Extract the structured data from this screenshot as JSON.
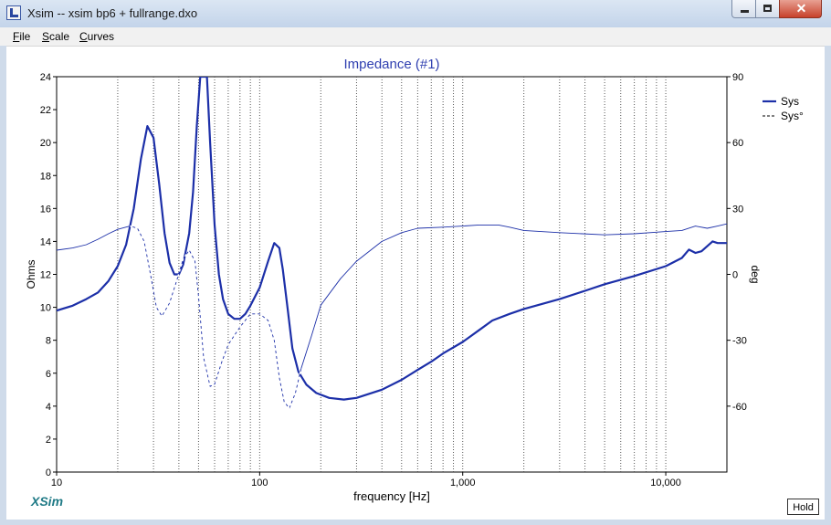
{
  "window": {
    "title": "Xsim -- xsim bp6 + fullrange.dxo",
    "icon": "xsim-app-icon"
  },
  "menu": {
    "file": {
      "first": "F",
      "rest": "ile"
    },
    "scale": {
      "first": "S",
      "rest": "cale"
    },
    "curves": {
      "first": "C",
      "rest": "urves"
    }
  },
  "branding": "XSim",
  "hold_label": "Hold",
  "colors": {
    "curve": "#1c2fa8",
    "title": "#2f3fb0",
    "grid": "#555555",
    "logo": "#1f7a86"
  },
  "chart_data": {
    "type": "line",
    "title": "Impedance (#1)",
    "xlabel": "frequency [Hz]",
    "ylabel": "Ohms",
    "y2label": "deg",
    "xscale": "log",
    "xlim": [
      10,
      20000
    ],
    "ylim": [
      0,
      24
    ],
    "y2lim": [
      -90,
      90
    ],
    "xticks": [
      10,
      100,
      1000,
      10000
    ],
    "xtick_labels": [
      "10",
      "100",
      "1,000",
      "10,000"
    ],
    "yticks": [
      0,
      2,
      4,
      6,
      8,
      10,
      12,
      14,
      16,
      18,
      20,
      22,
      24
    ],
    "y2ticks": [
      -60,
      -30,
      0,
      30,
      60,
      90
    ],
    "grid": true,
    "legend_position": "top-right",
    "series": [
      {
        "name": "Sys",
        "axis": "left",
        "style": "solid-bold",
        "points": [
          [
            10,
            9.8
          ],
          [
            12,
            10.1
          ],
          [
            14,
            10.5
          ],
          [
            16,
            10.9
          ],
          [
            18,
            11.6
          ],
          [
            20,
            12.5
          ],
          [
            22,
            13.8
          ],
          [
            24,
            16.0
          ],
          [
            26,
            19.0
          ],
          [
            28,
            21.0
          ],
          [
            30,
            20.3
          ],
          [
            32,
            17.5
          ],
          [
            34,
            14.5
          ],
          [
            36,
            12.7
          ],
          [
            38,
            12.0
          ],
          [
            40,
            12.0
          ],
          [
            42,
            12.6
          ],
          [
            45,
            14.5
          ],
          [
            47,
            17.0
          ],
          [
            49,
            21.0
          ],
          [
            51,
            24.0
          ],
          [
            55,
            24.0
          ],
          [
            57,
            20.0
          ],
          [
            60,
            15.0
          ],
          [
            63,
            12.0
          ],
          [
            66,
            10.5
          ],
          [
            70,
            9.6
          ],
          [
            75,
            9.3
          ],
          [
            80,
            9.3
          ],
          [
            85,
            9.6
          ],
          [
            90,
            10.1
          ],
          [
            100,
            11.2
          ],
          [
            110,
            12.8
          ],
          [
            118,
            13.9
          ],
          [
            125,
            13.6
          ],
          [
            130,
            12.3
          ],
          [
            137,
            10.0
          ],
          [
            145,
            7.5
          ],
          [
            155,
            6.1
          ],
          [
            170,
            5.3
          ],
          [
            190,
            4.8
          ],
          [
            220,
            4.5
          ],
          [
            260,
            4.4
          ],
          [
            300,
            4.5
          ],
          [
            400,
            5.0
          ],
          [
            500,
            5.6
          ],
          [
            600,
            6.2
          ],
          [
            700,
            6.7
          ],
          [
            800,
            7.2
          ],
          [
            1000,
            7.9
          ],
          [
            1200,
            8.6
          ],
          [
            1400,
            9.2
          ],
          [
            1700,
            9.6
          ],
          [
            2000,
            9.9
          ],
          [
            3000,
            10.5
          ],
          [
            4000,
            11.0
          ],
          [
            5000,
            11.4
          ],
          [
            7000,
            11.9
          ],
          [
            10000,
            12.5
          ],
          [
            12000,
            13.0
          ],
          [
            13000,
            13.5
          ],
          [
            14000,
            13.3
          ],
          [
            15000,
            13.4
          ],
          [
            17000,
            14.0
          ],
          [
            18000,
            13.9
          ],
          [
            20000,
            13.9
          ]
        ]
      },
      {
        "name": "Sys°",
        "axis": "right",
        "style": "dashed-thin",
        "points": [
          [
            10,
            11
          ],
          [
            12,
            12
          ],
          [
            14,
            13.5
          ],
          [
            16,
            16
          ],
          [
            18,
            18.5
          ],
          [
            20,
            20.5
          ],
          [
            23,
            22
          ],
          [
            25,
            21
          ],
          [
            27,
            15
          ],
          [
            29,
            0
          ],
          [
            31,
            -15
          ],
          [
            33,
            -19
          ],
          [
            36,
            -13
          ],
          [
            39,
            -3
          ],
          [
            42,
            7
          ],
          [
            45,
            11
          ],
          [
            48,
            6
          ],
          [
            50,
            -10
          ],
          [
            53,
            -38
          ],
          [
            57,
            -51
          ],
          [
            60,
            -50
          ],
          [
            65,
            -40
          ],
          [
            70,
            -32
          ],
          [
            80,
            -24
          ],
          [
            90,
            -18
          ],
          [
            100,
            -18
          ],
          [
            110,
            -21
          ],
          [
            118,
            -30
          ],
          [
            125,
            -47
          ],
          [
            132,
            -58
          ],
          [
            140,
            -61
          ],
          [
            150,
            -54
          ],
          [
            160,
            -43
          ],
          [
            180,
            -28
          ],
          [
            200,
            -14
          ],
          [
            250,
            -2
          ],
          [
            300,
            6
          ],
          [
            400,
            15
          ],
          [
            500,
            19
          ],
          [
            600,
            21
          ],
          [
            800,
            21.5
          ],
          [
            1000,
            22
          ],
          [
            1200,
            22.5
          ],
          [
            1500,
            22.5
          ],
          [
            1700,
            21.5
          ],
          [
            2000,
            20
          ],
          [
            3000,
            19
          ],
          [
            5000,
            18
          ],
          [
            7000,
            18.5
          ],
          [
            10000,
            19.5
          ],
          [
            12000,
            20
          ],
          [
            14000,
            22
          ],
          [
            16000,
            21
          ],
          [
            18000,
            22
          ],
          [
            20000,
            23
          ]
        ]
      }
    ]
  }
}
